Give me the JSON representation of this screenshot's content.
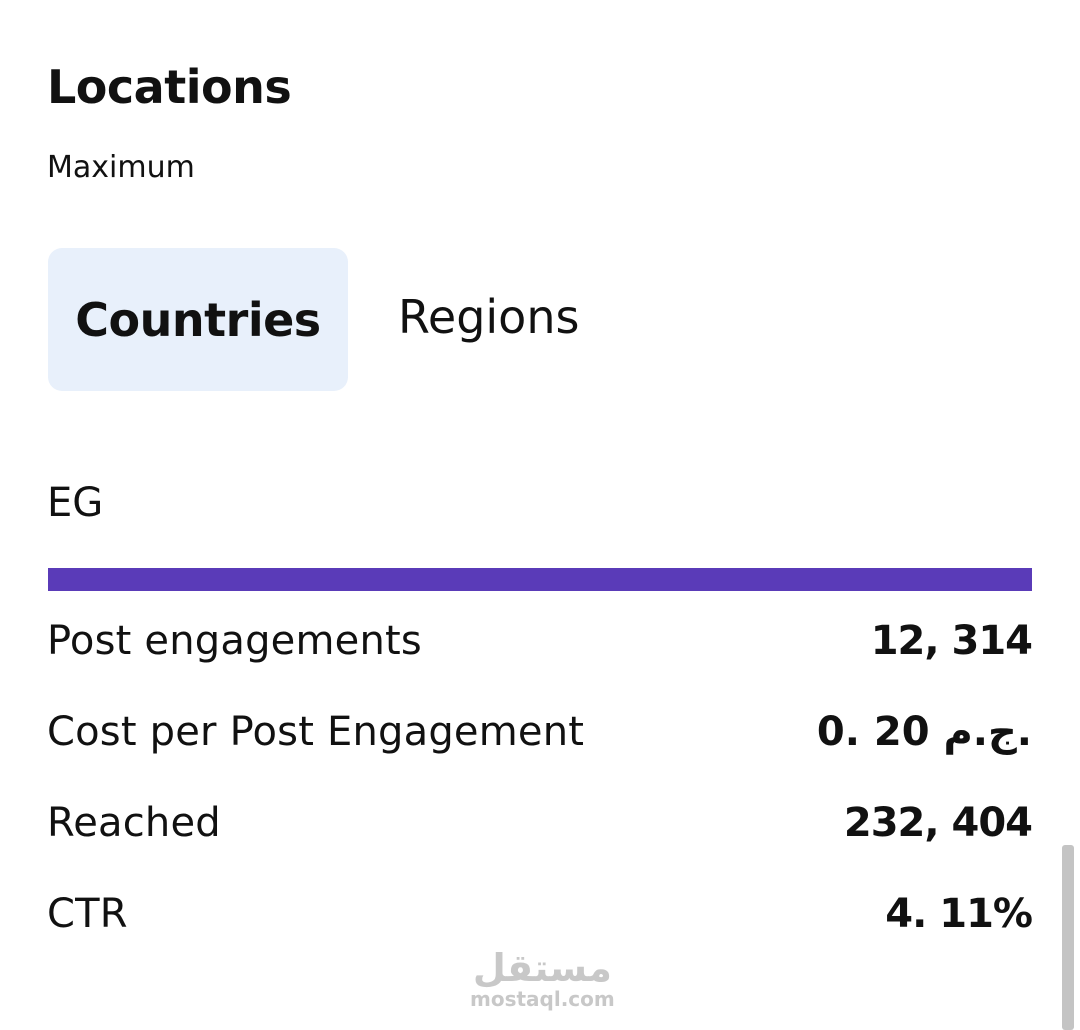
{
  "header": {
    "title": "Locations",
    "subtitle": "Maximum"
  },
  "tabs": [
    {
      "label": "Countries",
      "active": true
    },
    {
      "label": "Regions",
      "active": false
    }
  ],
  "country": {
    "code": "EG",
    "bar_fraction": 1.0,
    "bar_color": "#5a3bb8"
  },
  "metrics": [
    {
      "label": "Post engagements",
      "value": "12, 314"
    },
    {
      "label": "Cost per Post Engagement",
      "value": "0. 20 ج.م."
    },
    {
      "label": "Reached",
      "value": "232, 404"
    },
    {
      "label": "CTR",
      "value": "4. 11%"
    }
  ],
  "watermark": {
    "arabic": "مستقل",
    "latin": "mostaql.com"
  }
}
